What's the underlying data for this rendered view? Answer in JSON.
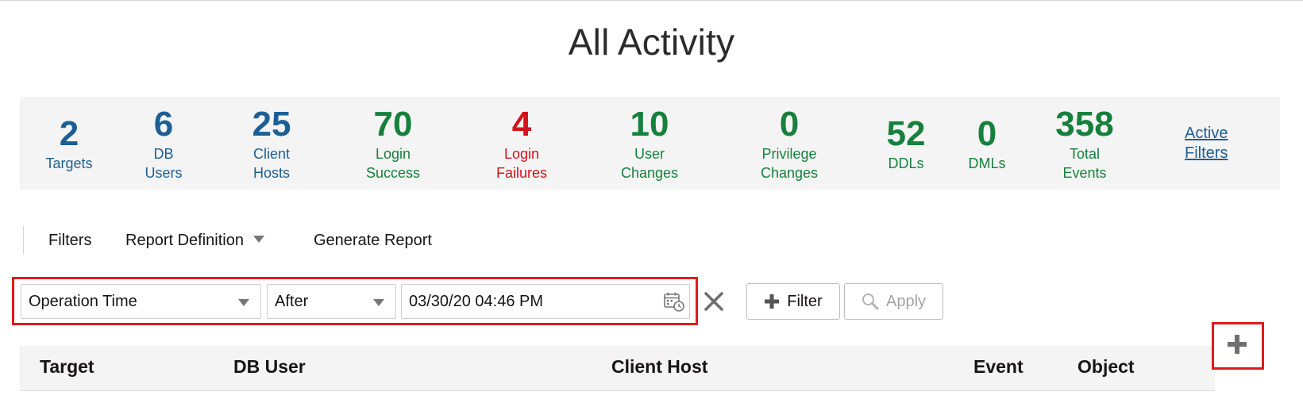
{
  "page": {
    "title": "All Activity"
  },
  "stats": [
    {
      "value": "2",
      "label": "Targets",
      "color": "#1d5f95"
    },
    {
      "value": "6",
      "label": "DB\nUsers",
      "color": "#1d5f95"
    },
    {
      "value": "25",
      "label": "Client\nHosts",
      "color": "#1d5f95"
    },
    {
      "value": "70",
      "label": "Login\nSuccess",
      "color": "#16803c"
    },
    {
      "value": "4",
      "label": "Login\nFailures",
      "color": "#d3121b"
    },
    {
      "value": "10",
      "label": "User\nChanges",
      "color": "#16803c"
    },
    {
      "value": "0",
      "label": "Privilege\nChanges",
      "color": "#16803c"
    },
    {
      "value": "52",
      "label": "DDLs",
      "color": "#16803c"
    },
    {
      "value": "0",
      "label": "DMLs",
      "color": "#16803c"
    },
    {
      "value": "358",
      "label": "Total\nEvents",
      "color": "#16803c"
    }
  ],
  "active_filters_link": "Active\nFilters",
  "toolbar": {
    "filters": "Filters",
    "report_definition": "Report Definition",
    "generate_report": "Generate Report"
  },
  "filter_row": {
    "field": "Operation Time",
    "operator": "After",
    "value": "03/30/20 04:46 PM"
  },
  "buttons": {
    "filter": "Filter",
    "apply": "Apply"
  },
  "table": {
    "columns": [
      "Target",
      "DB User",
      "Client Host",
      "Event",
      "Object"
    ]
  },
  "icons": {
    "calendar": "calendar-clock-icon",
    "clear": "close-icon",
    "add_filter": "plus-icon",
    "apply": "search-icon",
    "add_column": "plus-icon"
  }
}
